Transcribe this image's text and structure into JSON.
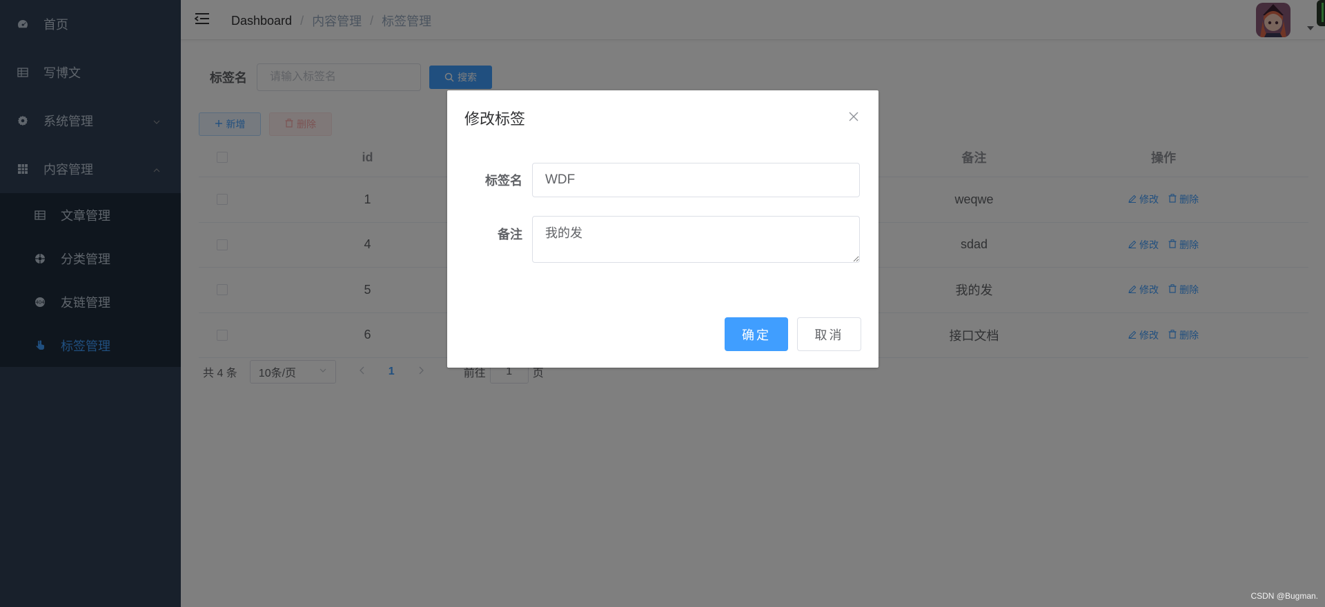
{
  "sidebar": {
    "items": [
      {
        "label": "首页",
        "icon": "dashboard-icon"
      },
      {
        "label": "写博文",
        "icon": "table-icon"
      },
      {
        "label": "系统管理",
        "icon": "gear-icon",
        "expanded": false
      },
      {
        "label": "内容管理",
        "icon": "grid-icon",
        "expanded": true
      }
    ],
    "sub_items": [
      {
        "label": "文章管理",
        "icon": "table-icon"
      },
      {
        "label": "分类管理",
        "icon": "category-icon"
      },
      {
        "label": "友链管理",
        "icon": "link-icon"
      },
      {
        "label": "标签管理",
        "icon": "tag-icon",
        "active": true
      }
    ]
  },
  "header": {
    "breadcrumb": [
      "Dashboard",
      "内容管理",
      "标签管理"
    ],
    "separator": "/"
  },
  "search": {
    "label": "标签名",
    "placeholder": "请输入标签名",
    "button_label": "搜索"
  },
  "actions": {
    "add_label": "新增",
    "delete_label": "删除"
  },
  "table": {
    "columns": [
      "id",
      "备注",
      "操作"
    ],
    "rows": [
      {
        "id": "1",
        "remark": "weqwe"
      },
      {
        "id": "4",
        "remark": "sdad"
      },
      {
        "id": "5",
        "remark": "我的发"
      },
      {
        "id": "6",
        "remark": "接口文档"
      }
    ],
    "edit_label": "修改",
    "delete_label": "删除"
  },
  "pagination": {
    "total": "共 4 条",
    "page_size": "10条/页",
    "current_page": "1",
    "goto_prefix": "前往",
    "goto_value": "1",
    "goto_suffix": "页"
  },
  "dialog": {
    "title": "修改标签",
    "name_label": "标签名",
    "name_value": "WDF",
    "remark_label": "备注",
    "remark_value": "我的发",
    "ok_label": "确定",
    "cancel_label": "取消"
  },
  "watermark": "CSDN @Bugman.",
  "colors": {
    "primary": "#409eff",
    "sidebar_bg": "#304156",
    "submenu_bg": "#1f2d3d",
    "danger_light": "#fef0f0"
  }
}
